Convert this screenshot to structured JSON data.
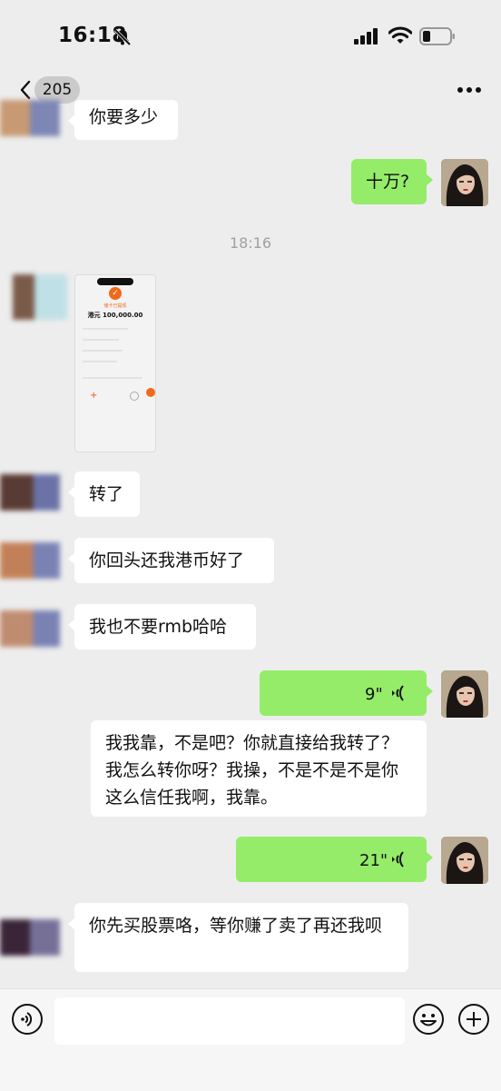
{
  "status_bar": {
    "time": "16:18"
  },
  "nav": {
    "unread_count": "205"
  },
  "messages": {
    "partial": "你要多少",
    "out_1": "十万?",
    "timestamp": "18:16",
    "image": {
      "status": "储卡已提现",
      "amount": "港元 100,000.00"
    },
    "in_2": "转了",
    "in_3": "你回头还我港币好了",
    "in_4": "我也不要rmb哈哈",
    "voice_1": {
      "duration": "9\"",
      "transcript": "我我靠，不是吧？你就直接给我转了？我怎么转你呀？我操，不是不是不是你这么信任我啊，我靠。"
    },
    "voice_2": {
      "duration": "21\""
    },
    "in_5": "你先买股票咯，等你赚了卖了再还我呗"
  },
  "colors": {
    "outgoing_bubble": "#95ec69",
    "incoming_bubble": "#ffffff",
    "background": "#ededed"
  }
}
